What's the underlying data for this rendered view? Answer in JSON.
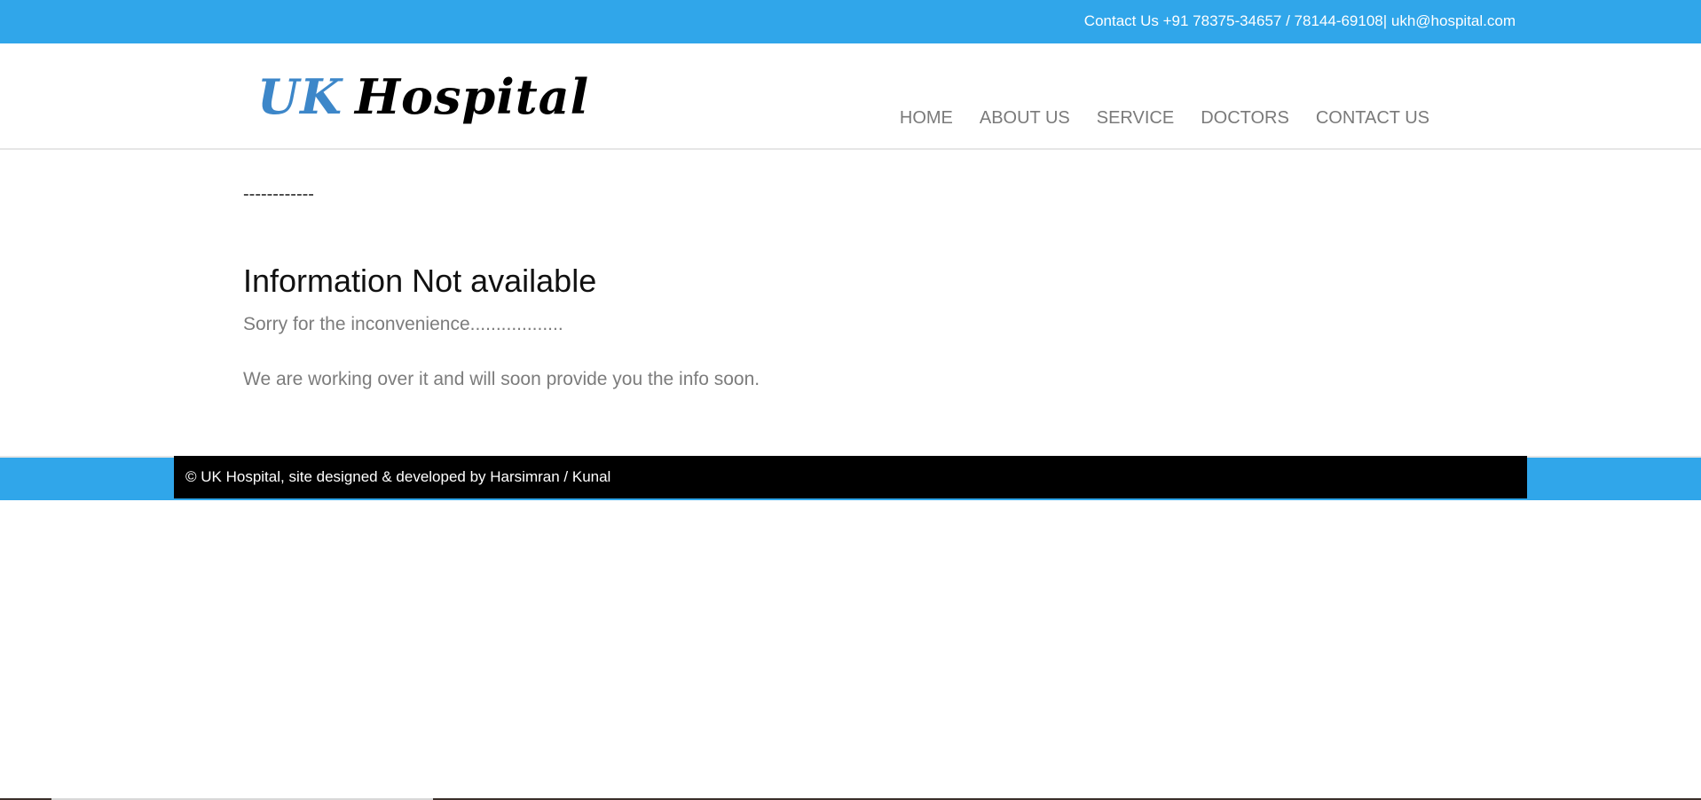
{
  "topbar": {
    "contact": "Contact Us +91 78375-34657 / 78144-69108| ukh@hospital.com"
  },
  "logo": {
    "part1": "UK",
    "part2": "Hospital"
  },
  "nav": {
    "items": [
      {
        "label": "HOME"
      },
      {
        "label": "ABOUT US"
      },
      {
        "label": "SERVICE"
      },
      {
        "label": "DOCTORS"
      },
      {
        "label": "CONTACT US"
      }
    ]
  },
  "content": {
    "dashes": "------------",
    "heading": "Information Not available",
    "para1": "Sorry for the inconvenience..................",
    "para2": "We are working over it and will soon provide you the info soon."
  },
  "footer": {
    "text": "© UK Hospital, site designed & developed by Harsimran / Kunal"
  },
  "colors": {
    "accent": "#30a6ea",
    "logo_blue": "#3d87c9",
    "nav_text": "#7a7a7a",
    "footer_bg": "#000000"
  }
}
